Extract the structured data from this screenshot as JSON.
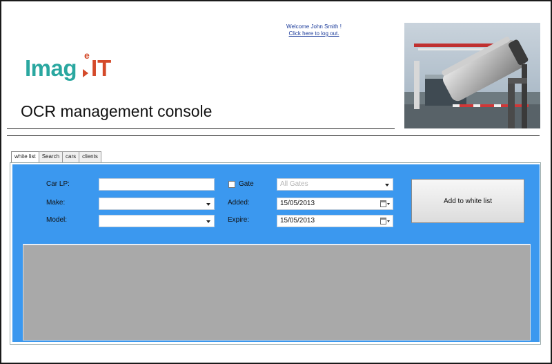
{
  "header": {
    "welcome_text": "Welcome John Smith !",
    "logout_link": "Click here to log out.",
    "app_title": "OCR management console"
  },
  "logo": {
    "part1": "Imag",
    "part2": "e",
    "part3": "IT",
    "colors": {
      "teal": "#2aa7a0",
      "red": "#d44a2a"
    }
  },
  "tabs": [
    {
      "label": "white list",
      "active": true
    },
    {
      "label": "Search"
    },
    {
      "label": "cars"
    },
    {
      "label": "clients"
    }
  ],
  "form": {
    "car_lp": {
      "label": "Car LP:",
      "value": ""
    },
    "make": {
      "label": "Make:",
      "value": ""
    },
    "model": {
      "label": "Model:",
      "value": ""
    },
    "gate": {
      "label": "Gate",
      "checked": false,
      "selected": "All Gates"
    },
    "added": {
      "label": "Added:",
      "value": "15/05/2013"
    },
    "expire": {
      "label": "Expire:",
      "value": "15/05/2013"
    }
  },
  "actions": {
    "add_label": "Add to white list"
  },
  "colors": {
    "panel": "#3b98ef",
    "grid": "#a9a9a9"
  }
}
